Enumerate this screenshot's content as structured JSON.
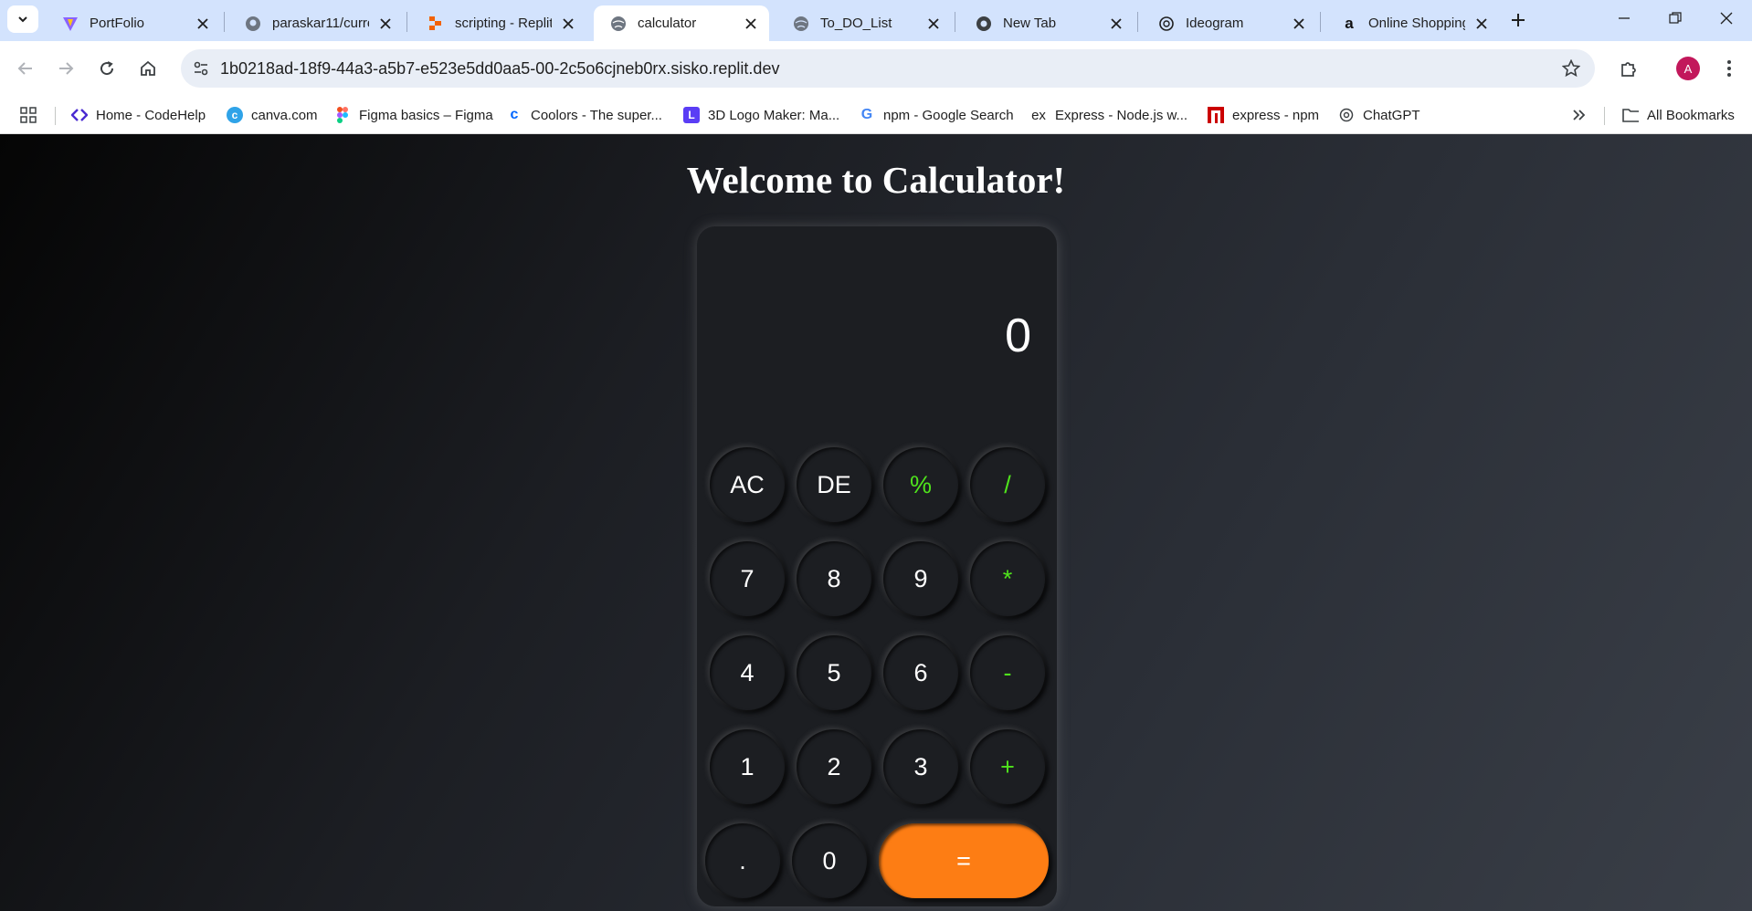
{
  "browser": {
    "tabs": [
      {
        "title": "PortFolio",
        "icon": "vite-logo-icon"
      },
      {
        "title": "paraskar11/curre",
        "icon": "github-icon"
      },
      {
        "title": "scripting - Replit",
        "icon": "replit-icon"
      },
      {
        "title": "calculator",
        "icon": "globe-icon",
        "active": true
      },
      {
        "title": "To_DO_List",
        "icon": "globe-icon"
      },
      {
        "title": "New Tab",
        "icon": "chrome-icon"
      },
      {
        "title": "Ideogram",
        "icon": "ideogram-icon"
      },
      {
        "title": "Online Shopping",
        "icon": "amazon-icon"
      }
    ],
    "url": "1b0218ad-18f9-44a3-a5b7-e523e5dd0aa5-00-2c5o6cjneb0rx.sisko.replit.dev",
    "profile_initial": "A",
    "bookmarks": [
      {
        "label": "Home - CodeHelp",
        "icon": "codehelp-icon"
      },
      {
        "label": "canva.com",
        "icon": "canva-icon"
      },
      {
        "label": "Figma basics – Figma",
        "icon": "figma-icon"
      },
      {
        "label": "Coolors - The super...",
        "icon": "coolors-icon"
      },
      {
        "label": "3D Logo Maker: Ma...",
        "icon": "logo-maker-icon"
      },
      {
        "label": "npm - Google Search",
        "icon": "google-icon"
      },
      {
        "label": "Express - Node.js w...",
        "icon": "express-icon"
      },
      {
        "label": "express - npm",
        "icon": "npm-icon"
      },
      {
        "label": "ChatGPT",
        "icon": "chatgpt-icon"
      }
    ],
    "all_bookmarks_label": "All Bookmarks"
  },
  "page": {
    "heading": "Welcome to Calculator!",
    "display_value": "0",
    "keys": {
      "ac": "AC",
      "de": "DE",
      "percent": "%",
      "divide": "/",
      "seven": "7",
      "eight": "8",
      "nine": "9",
      "multiply": "*",
      "four": "4",
      "five": "5",
      "six": "6",
      "minus": "-",
      "one": "1",
      "two": "2",
      "three": "3",
      "plus": "+",
      "dot": ".",
      "zero": "0",
      "equals": "="
    },
    "colors": {
      "operator": "#4fe31c",
      "equals": "#fd7d14",
      "calculator_bg": "#1c1e22"
    }
  }
}
